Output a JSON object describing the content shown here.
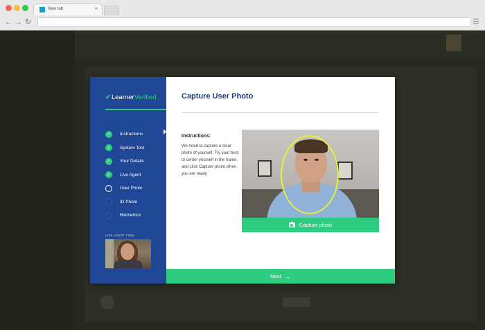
{
  "browser": {
    "tab_title": "New tab",
    "tab_close": "×",
    "back": "←",
    "forward": "→",
    "reload": "↻",
    "menu": "☰"
  },
  "modal": {
    "logo_check": "✔",
    "logo_part1": "Learner",
    "logo_part2": "Verified",
    "title": "Capture User Photo",
    "steps": [
      {
        "label": "Instructions",
        "state": "done"
      },
      {
        "label": "System Test",
        "state": "done"
      },
      {
        "label": "Your Details",
        "state": "done"
      },
      {
        "label": "Live Agent",
        "state": "done"
      },
      {
        "label": "User Photo",
        "state": "current"
      },
      {
        "label": "ID Photo",
        "state": "todo"
      },
      {
        "label": "Biometrics",
        "state": "todo"
      }
    ],
    "step_check": "✓",
    "live_agent_feed_label": "LIVE AGENT FEED",
    "instructions_heading": "Instructions:",
    "instructions_text": "We need to capture a clear photo of yourself. Try your best to center yourself in the frame, and click Capture photo when you are ready",
    "capture_button": "Capture photo",
    "next_button": "Next",
    "next_arrow": "→"
  },
  "colors": {
    "sidebar": "#1f4795",
    "accent_green": "#2ecc80",
    "title_blue": "#1f3e7c",
    "face_guide": "#e3f23a"
  }
}
